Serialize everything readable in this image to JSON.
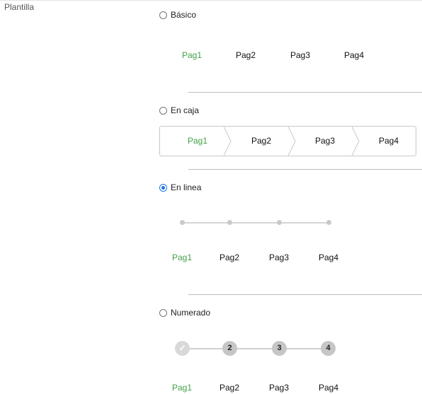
{
  "field_label": "Plantilla",
  "options": [
    {
      "label": "Básico",
      "checked": false
    },
    {
      "label": "En caja",
      "checked": false
    },
    {
      "label": "En linea",
      "checked": true
    },
    {
      "label": "Numerado",
      "checked": false
    }
  ],
  "steps": [
    "Pag1",
    "Pag2",
    "Pag3",
    "Pag4"
  ],
  "numbers": [
    "✓",
    "2",
    "3",
    "4"
  ],
  "colors": {
    "active": "#43a047",
    "radio_checked": "#1a73e8"
  }
}
